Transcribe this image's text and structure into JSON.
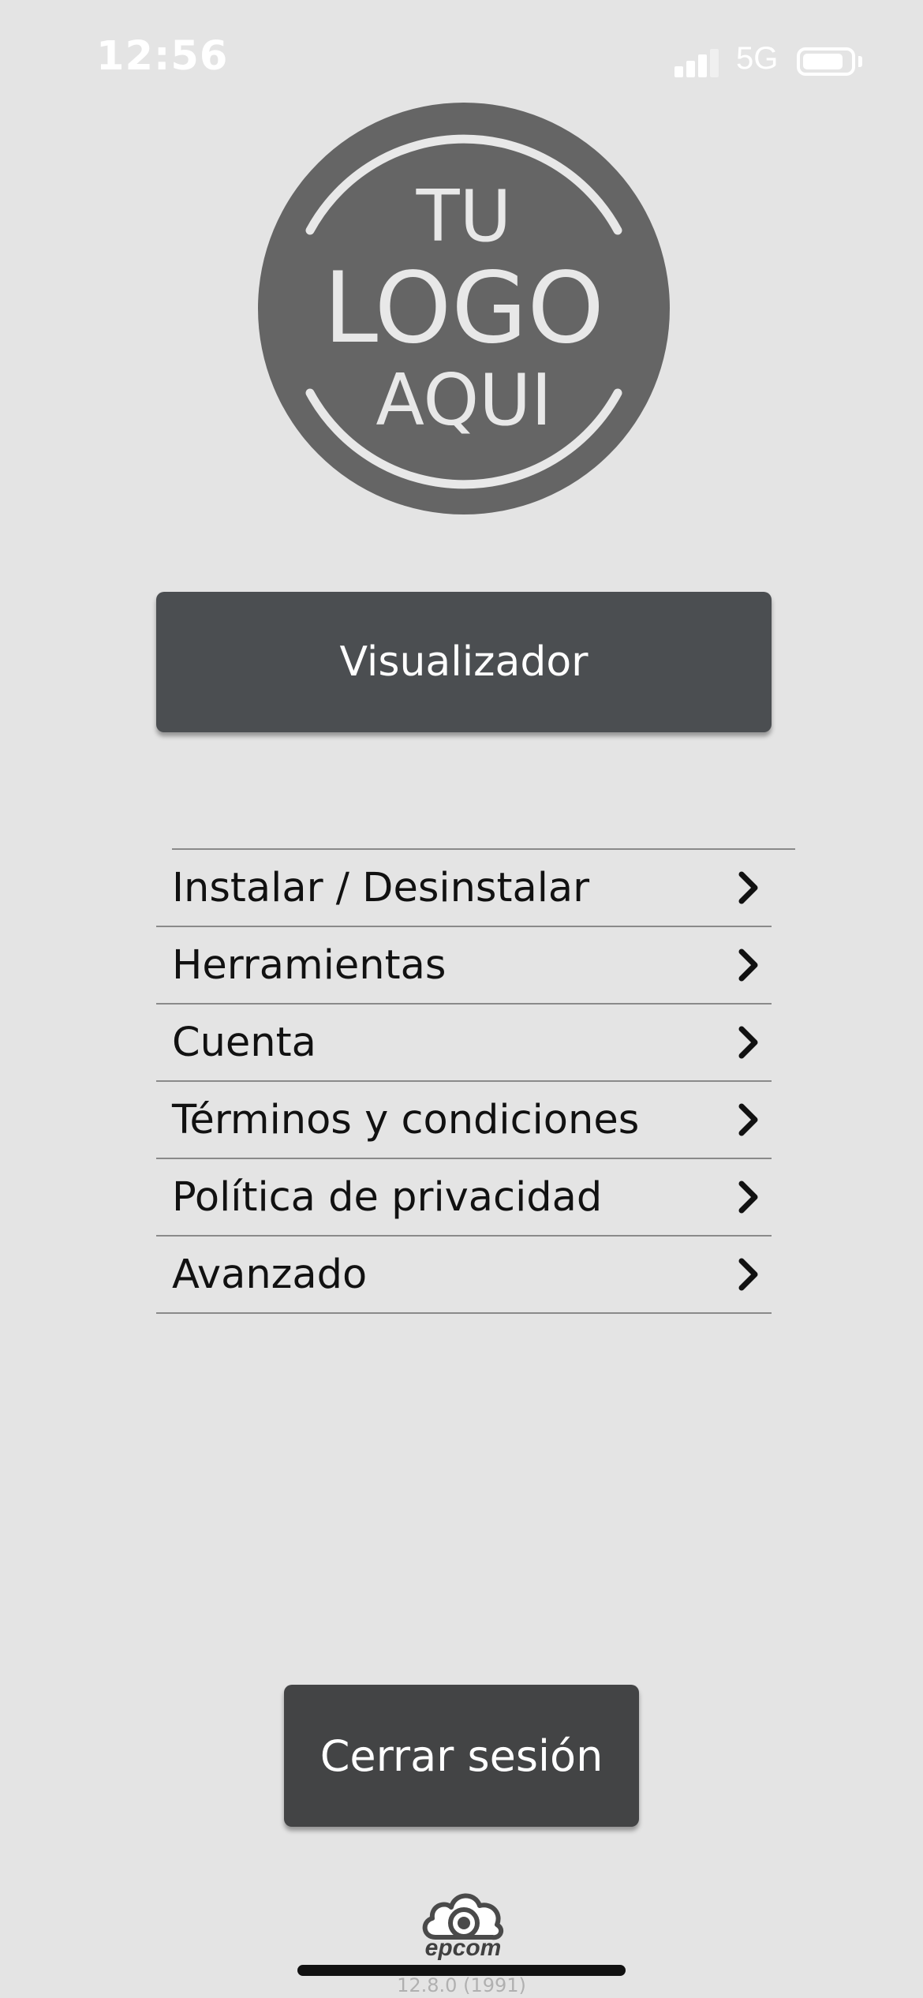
{
  "status_bar": {
    "time": "12:56",
    "network": "5G",
    "signal_bars": 3,
    "signal_bars_total": 4
  },
  "logo": {
    "line1": "TU",
    "line2": "LOGO",
    "line3": "AQUI"
  },
  "viewer_button": "Visualizador",
  "menu": {
    "items": [
      {
        "label": "Instalar / Desinstalar",
        "icon": "chevron-right-icon"
      },
      {
        "label": "Herramientas",
        "icon": "chevron-right-icon"
      },
      {
        "label": "Cuenta",
        "icon": "chevron-right-icon"
      },
      {
        "label": "Términos y condiciones",
        "icon": "chevron-right-icon"
      },
      {
        "label": "Política de privacidad",
        "icon": "chevron-right-icon"
      },
      {
        "label": "Avanzado",
        "icon": "chevron-right-icon"
      }
    ]
  },
  "logout_button": "Cerrar sesión",
  "footer": {
    "brand": "epcom",
    "version": "12.8.0 (1991)"
  },
  "colors": {
    "background": "#e4e4e4",
    "button": "#4b4e51",
    "logo_circle": "#656565",
    "logo_text": "#e8e8e8"
  }
}
